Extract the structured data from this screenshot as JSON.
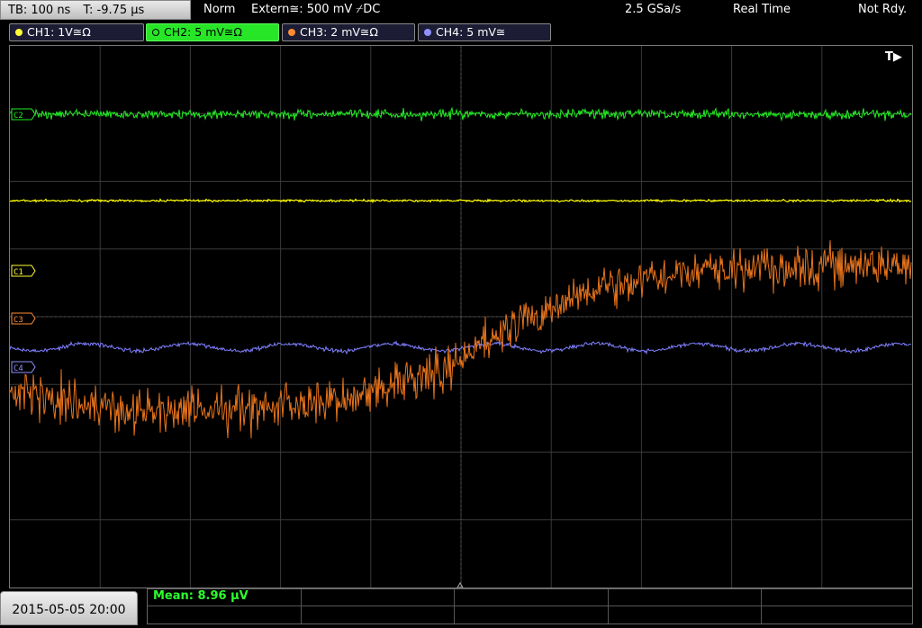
{
  "topbar": {
    "timebase": "TB: 100 ns",
    "trigger_time": "T: -9.75 µs",
    "mode": "Norm",
    "trigger": "Extern≅: 500 mV ⌿DC",
    "sample_rate": "2.5 GSa/s",
    "acq_mode": "Real Time",
    "status": "Not Rdy."
  },
  "channels": [
    {
      "label": "CH1: 1V≅Ω",
      "color": "#ffff33",
      "active": false
    },
    {
      "label": "CH2: 5 mV≅Ω",
      "color": "#ffffff",
      "active": true
    },
    {
      "label": "CH3: 2 mV≅Ω",
      "color": "#ff8c33",
      "active": false
    },
    {
      "label": "CH4: 5 mV≅",
      "color": "#9090ff",
      "active": false
    }
  ],
  "markers": {
    "c1": "C1",
    "c2": "C2",
    "c3": "C3",
    "c4": "C4",
    "trigger": "T▶"
  },
  "bottom": {
    "datetime": "2015-05-05 20:00",
    "mean": "Mean: 8.96 µV"
  },
  "colors": {
    "ch1": "#ffff00",
    "ch2": "#22ee22",
    "ch3": "#e8741c",
    "ch4": "#7f7fff",
    "grid": "#3a3a3a"
  }
}
